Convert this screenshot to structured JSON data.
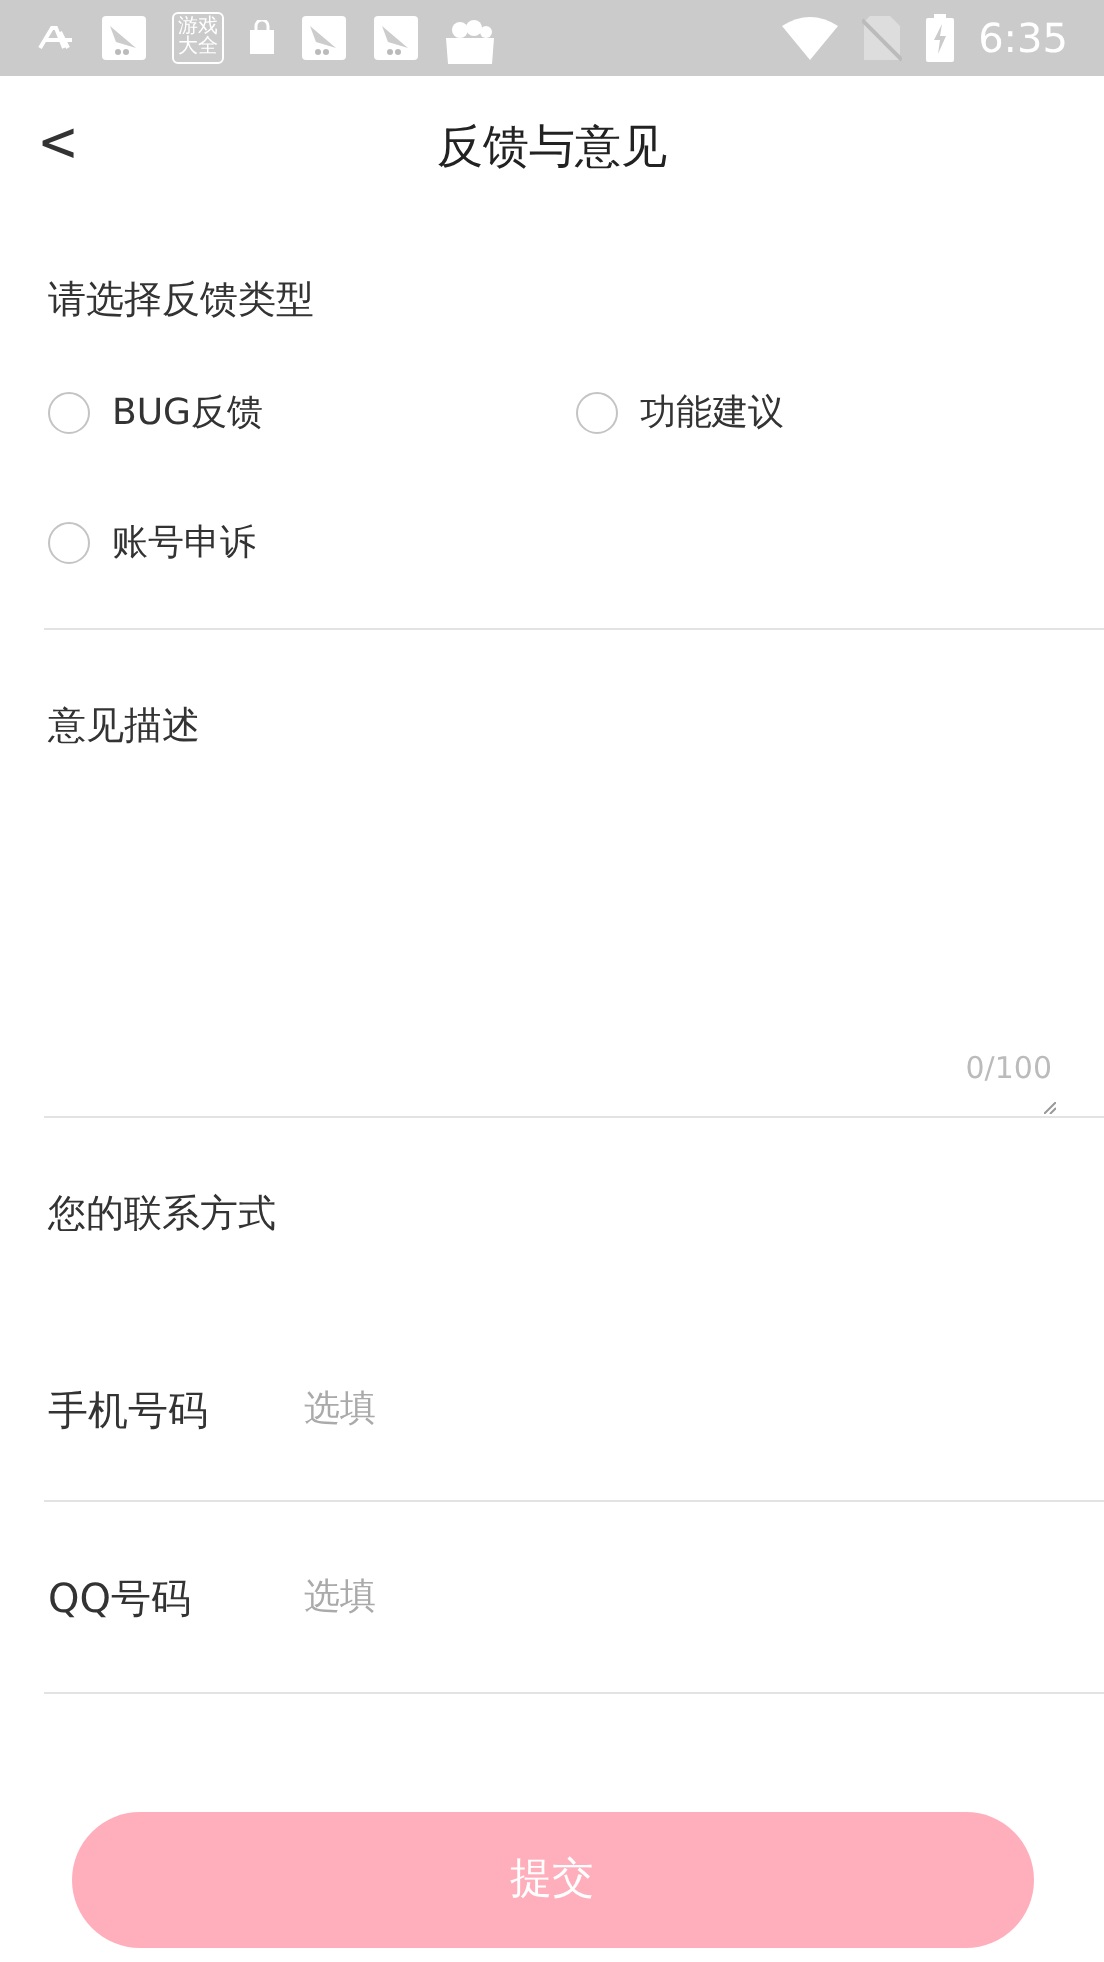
{
  "status_bar": {
    "app_icon_text": [
      "游戏",
      "大全"
    ],
    "time": "6:35"
  },
  "header": {
    "back": "<",
    "title": "反馈与意见"
  },
  "feedback_type": {
    "label": "请选择反馈类型",
    "options": [
      {
        "label": "BUG反馈",
        "selected": false
      },
      {
        "label": "功能建议",
        "selected": false
      },
      {
        "label": "账号申诉",
        "selected": false
      }
    ]
  },
  "description": {
    "label": "意见描述",
    "counter": "0/100"
  },
  "contact": {
    "label": "您的联系方式",
    "fields": [
      {
        "label": "手机号码",
        "placeholder": "选填"
      },
      {
        "label": "QQ号码",
        "placeholder": "选填"
      }
    ]
  },
  "submit": {
    "label": "提交",
    "disabled": true
  }
}
